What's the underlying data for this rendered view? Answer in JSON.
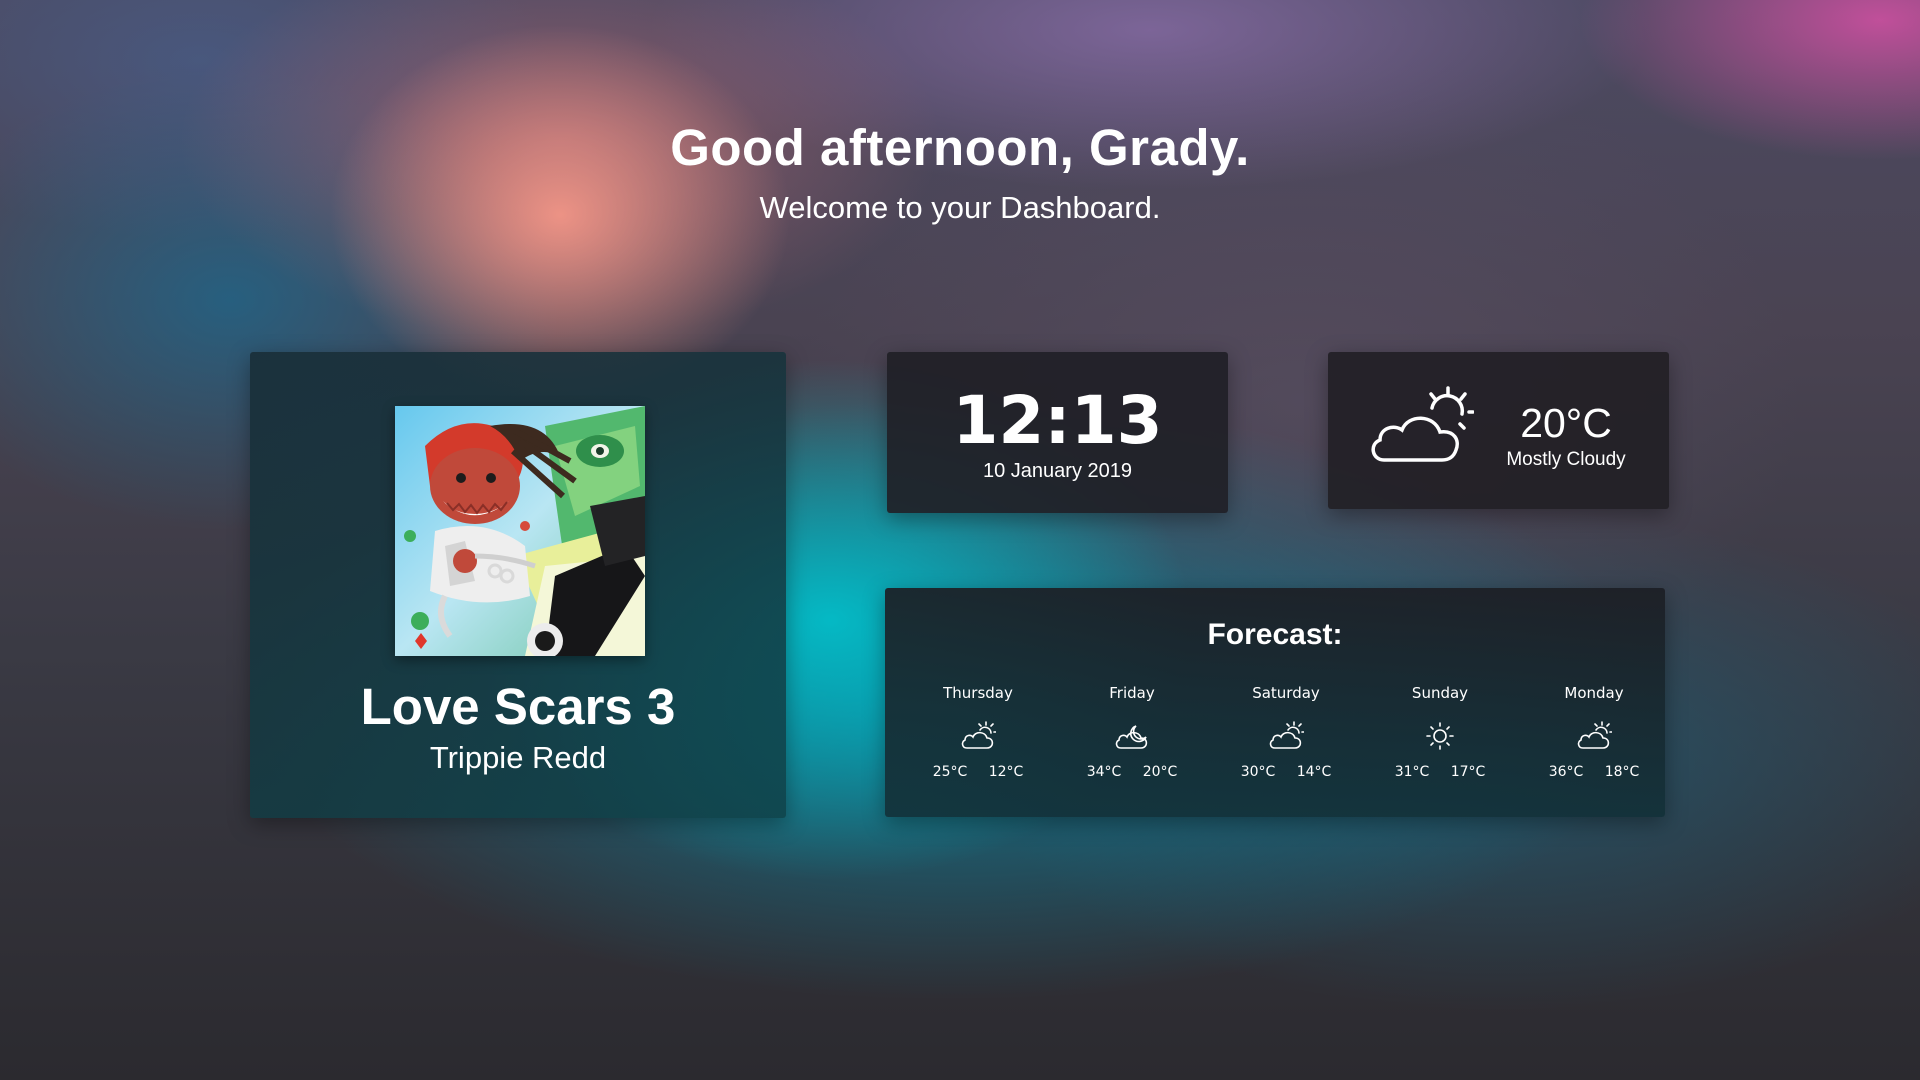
{
  "greeting": "Good afternoon, Grady.",
  "welcome": "Welcome to your Dashboard.",
  "music": {
    "title": "Love Scars 3",
    "artist": "Trippie Redd"
  },
  "clock": {
    "time": "12:13",
    "date": "10 January 2019"
  },
  "weather": {
    "icon": "partly-cloudy-icon",
    "temperature": "20°C",
    "condition": "Mostly Cloudy"
  },
  "forecast": {
    "title": "Forecast:",
    "days": [
      {
        "name": "Thursday",
        "icon": "partly-cloudy-icon",
        "high": "25°C",
        "low": "12°C"
      },
      {
        "name": "Friday",
        "icon": "cloudy-night-icon",
        "high": "34°C",
        "low": "20°C"
      },
      {
        "name": "Saturday",
        "icon": "partly-cloudy-icon",
        "high": "30°C",
        "low": "14°C"
      },
      {
        "name": "Sunday",
        "icon": "sun-icon",
        "high": "31°C",
        "low": "17°C"
      },
      {
        "name": "Monday",
        "icon": "partly-cloudy-icon",
        "high": "36°C",
        "low": "18°C"
      }
    ]
  },
  "colors": {
    "accent_warm": "#f39687",
    "accent_teal": "#00c8d2",
    "accent_pink": "#cd50a0",
    "card_dark": "#202026",
    "text": "#ffffff"
  }
}
